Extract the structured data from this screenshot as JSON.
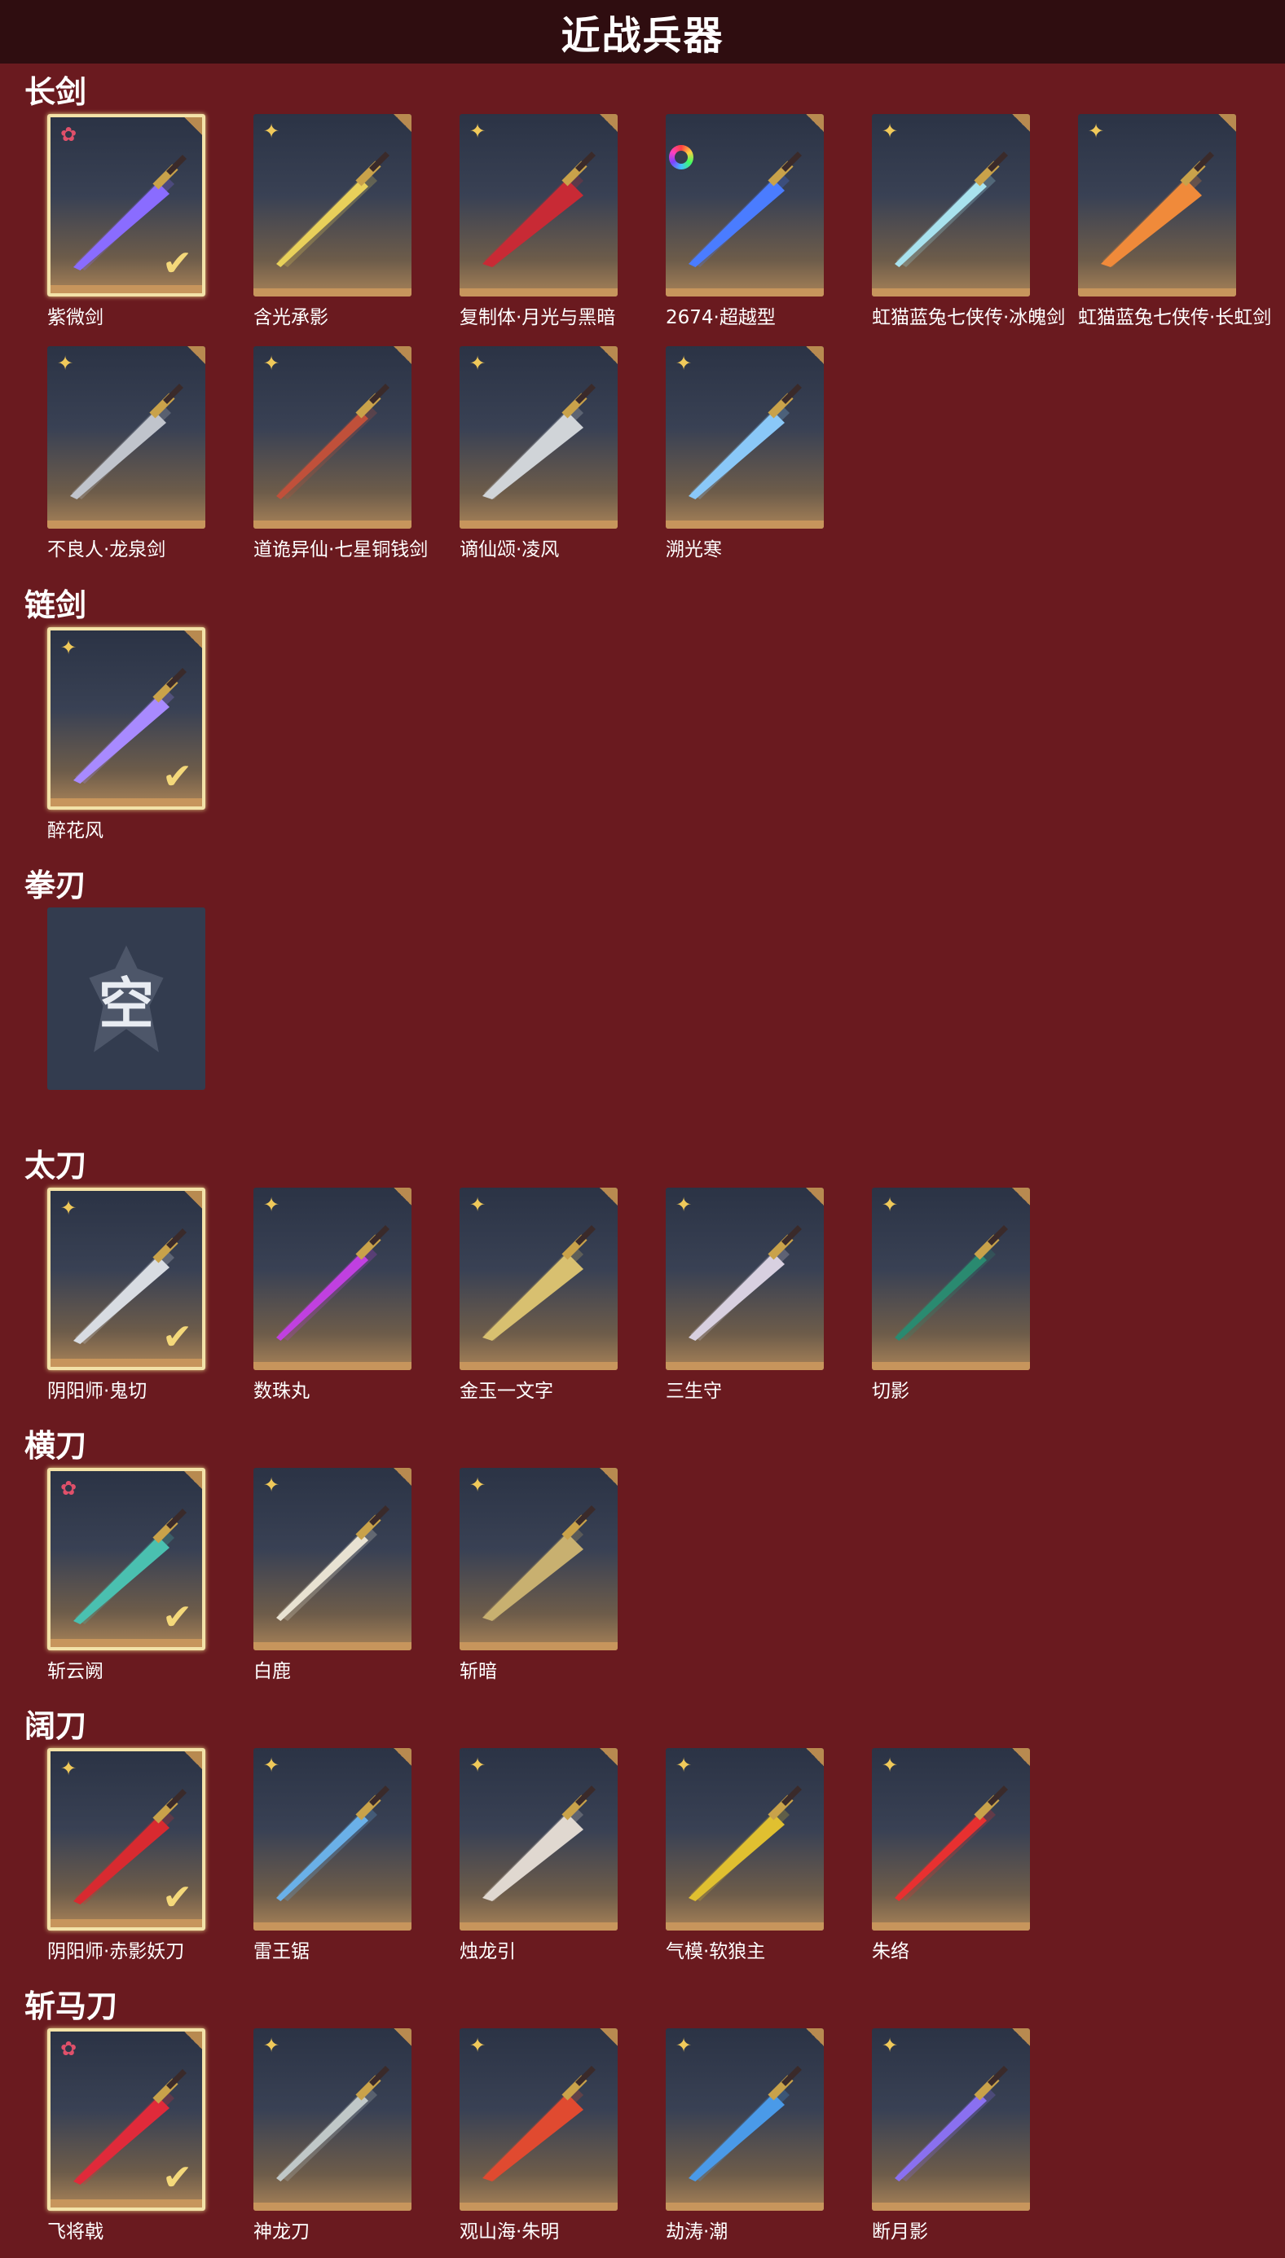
{
  "page": {
    "title": "近战兵器"
  },
  "colors": {
    "background": "#6a1a1f",
    "header": "#2f0d10",
    "equipped_border": "#f3e2a8",
    "gold_star": "#f0c95a",
    "red_star": "#e0506a"
  },
  "sections": [
    {
      "title": "长剑",
      "items": [
        {
          "name": "紫微剑",
          "rarity": "red-star-icon",
          "equipped": true,
          "blade": "#8a6cff"
        },
        {
          "name": "含光承影",
          "rarity": "gold-star-icon",
          "equipped": false,
          "blade": "#e8d05a"
        },
        {
          "name": "复制体·月光与黑暗",
          "rarity": "gold-star-icon",
          "equipped": false,
          "blade": "#c82a35"
        },
        {
          "name": "2674·超越型",
          "rarity": "rainbow-ring-icon",
          "equipped": false,
          "blade": "#4a7cff"
        },
        {
          "name": "虹猫蓝兔七侠传·冰魄剑",
          "rarity": "gold-star-icon",
          "equipped": false,
          "blade": "#a8e2ee"
        },
        {
          "name": "虹猫蓝兔七侠传·长虹剑",
          "rarity": "gold-star-icon",
          "equipped": false,
          "blade": "#f08a3a"
        },
        {
          "name": "不良人·龙泉剑",
          "rarity": "gold-star-icon",
          "equipped": false,
          "blade": "#c0c4cc"
        },
        {
          "name": "道诡异仙·七星铜钱剑",
          "rarity": "gold-star-icon",
          "equipped": false,
          "blade": "#c0503a"
        },
        {
          "name": "谪仙颂·凌风",
          "rarity": "gold-star-icon",
          "equipped": false,
          "blade": "#d0d4d8"
        },
        {
          "name": "溯光寒",
          "rarity": "gold-star-icon",
          "equipped": false,
          "blade": "#8ac8f8"
        }
      ]
    },
    {
      "title": "链剑",
      "items": [
        {
          "name": "醉花风",
          "rarity": "gold-star-icon",
          "equipped": true,
          "blade": "#a88aff"
        }
      ]
    },
    {
      "title": "拳刃",
      "items": [
        {
          "name": "",
          "empty": true,
          "empty_label": "空"
        }
      ]
    },
    {
      "title": "太刀",
      "items": [
        {
          "name": "阴阳师·鬼切",
          "rarity": "gold-star-icon",
          "equipped": true,
          "blade": "#d8dce2"
        },
        {
          "name": "数珠丸",
          "rarity": "gold-star-icon",
          "equipped": false,
          "blade": "#c040e0"
        },
        {
          "name": "金玉一文字",
          "rarity": "gold-star-icon",
          "equipped": false,
          "blade": "#d8c070"
        },
        {
          "name": "三生守",
          "rarity": "gold-star-icon",
          "equipped": false,
          "blade": "#d8d0e0"
        },
        {
          "name": "切影",
          "rarity": "gold-star-icon",
          "equipped": false,
          "blade": "#2a8a70"
        }
      ]
    },
    {
      "title": "横刀",
      "items": [
        {
          "name": "斩云阙",
          "rarity": "red-star-icon",
          "equipped": true,
          "blade": "#4ac0b0"
        },
        {
          "name": "白鹿",
          "rarity": "gold-star-icon",
          "equipped": false,
          "blade": "#e8e2d2"
        },
        {
          "name": "斩暗",
          "rarity": "gold-star-icon",
          "equipped": false,
          "blade": "#c8b070"
        }
      ]
    },
    {
      "title": "阔刀",
      "items": [
        {
          "name": "阴阳师·赤影妖刀",
          "rarity": "gold-star-icon",
          "equipped": true,
          "blade": "#d82a30"
        },
        {
          "name": "雷王锯",
          "rarity": "gold-star-icon",
          "equipped": false,
          "blade": "#6ab0e8"
        },
        {
          "name": "烛龙引",
          "rarity": "gold-star-icon",
          "equipped": false,
          "blade": "#e0d8d0"
        },
        {
          "name": "气模·软狼主",
          "rarity": "gold-star-icon",
          "equipped": false,
          "blade": "#e0c030"
        },
        {
          "name": "朱络",
          "rarity": "gold-star-icon",
          "equipped": false,
          "blade": "#e83030"
        }
      ]
    },
    {
      "title": "斩马刀",
      "items": [
        {
          "name": "飞将戟",
          "rarity": "red-star-icon",
          "equipped": true,
          "blade": "#e02a3a"
        },
        {
          "name": "神龙刀",
          "rarity": "gold-star-icon",
          "equipped": false,
          "blade": "#c0c8c8"
        },
        {
          "name": "观山海·朱明",
          "rarity": "gold-star-icon",
          "equipped": false,
          "blade": "#e04a30"
        },
        {
          "name": "劫涛·潮",
          "rarity": "gold-star-icon",
          "equipped": false,
          "blade": "#4a9ae8"
        },
        {
          "name": "断月影",
          "rarity": "gold-star-icon",
          "equipped": false,
          "blade": "#8a70f0"
        }
      ]
    }
  ]
}
